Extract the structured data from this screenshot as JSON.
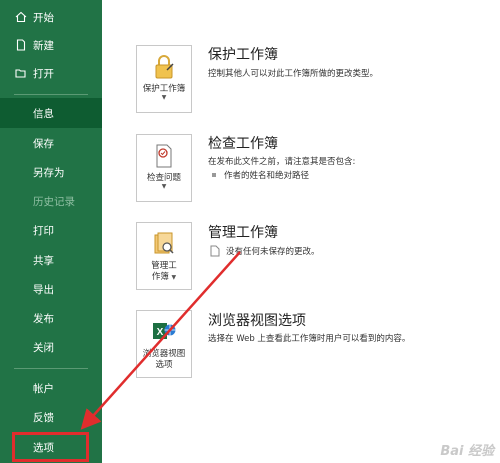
{
  "sidebar": {
    "items_top": [
      {
        "label": "开始",
        "icon": "home-icon"
      },
      {
        "label": "新建",
        "icon": "new-document-icon"
      },
      {
        "label": "打开",
        "icon": "open-folder-icon"
      }
    ],
    "items_middle": [
      {
        "label": "信息",
        "selected": true
      },
      {
        "label": "保存"
      },
      {
        "label": "另存为"
      },
      {
        "label": "历史记录",
        "disabled": true
      },
      {
        "label": "打印"
      },
      {
        "label": "共享"
      },
      {
        "label": "导出"
      },
      {
        "label": "发布"
      },
      {
        "label": "关闭"
      }
    ],
    "items_bottom": [
      {
        "label": "帐户"
      },
      {
        "label": "反馈"
      },
      {
        "label": "选项",
        "highlighted": true
      }
    ],
    "background": "#217346",
    "selected_background": "#0e5c31"
  },
  "sections": {
    "protect": {
      "card_label": "保护工作簿",
      "title": "保护工作簿",
      "description": "控制其他人可以对此工作簿所做的更改类型。"
    },
    "inspect": {
      "card_label": "检查问题",
      "title": "检查工作簿",
      "description": "在发布此文件之前，请注意其是否包含:",
      "bullet": "作者的姓名和绝对路径"
    },
    "manage": {
      "card_label_line1": "管理工",
      "card_label_line2": "作簿",
      "title": "管理工作簿",
      "description": "没有任何未保存的更改。"
    },
    "browser": {
      "card_label_line1": "浏览器视图",
      "card_label_line2": "选项",
      "title": "浏览器视图选项",
      "description": "选择在 Web 上查看此工作簿时用户可以看到的内容。"
    }
  },
  "annotation": {
    "color": "#e02d2d"
  },
  "watermark": "Bai 经验"
}
